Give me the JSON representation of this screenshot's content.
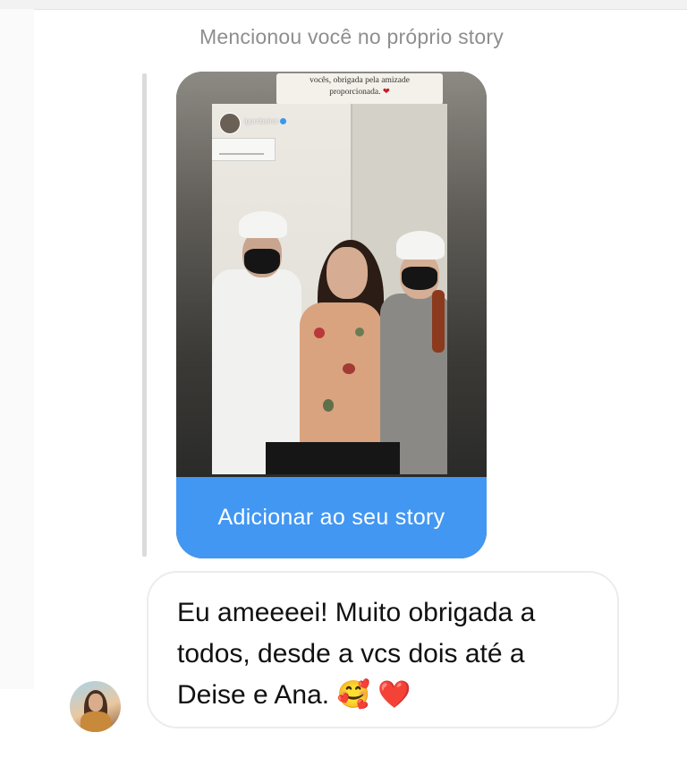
{
  "header": {
    "mention_caption": "Mencionou você no próprio story"
  },
  "story": {
    "overlay_text_line1": "vocês, obrigada pela amizade",
    "overlay_text_line2": "proporcionada.",
    "overlay_heart": "❤",
    "tagged_username": "igorribeiror",
    "add_button_label": "Adicionar ao seu story",
    "button_color": "#4297f2"
  },
  "message": {
    "line1": "Eu ameeeei! Muito obrigada a",
    "line2": "todos, desde a vcs dois até a",
    "line3": "Deise e Ana.",
    "emoji_smile": "🥰",
    "emoji_heart": "❤️"
  },
  "icons": {
    "verified": "verified-badge-icon"
  }
}
